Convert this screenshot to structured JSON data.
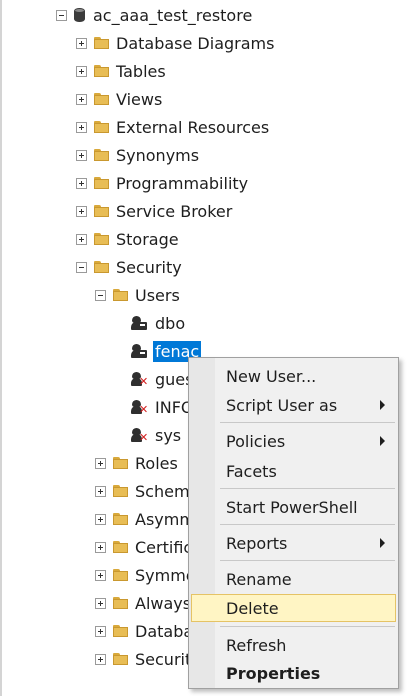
{
  "tree": {
    "database": "ac_aaa_test_restore",
    "folders": [
      "Database Diagrams",
      "Tables",
      "Views",
      "External Resources",
      "Synonyms",
      "Programmability",
      "Service Broker",
      "Storage",
      "Security"
    ],
    "security": {
      "users_folder": "Users",
      "users": [
        "dbo",
        "fenac",
        "guest",
        "INFORMATION_SCHEMA",
        "sys"
      ],
      "users_visible": [
        "dbo",
        "fenac",
        "gues",
        "INFO",
        "sys"
      ],
      "selected_user": "fenac",
      "folders": [
        "Roles",
        "Schemas",
        "Asymmetric Keys",
        "Certificates",
        "Symmetric Keys",
        "Always Encrypted Keys",
        "Database Audit Specifications",
        "Security Policies"
      ],
      "folders_visible": [
        "Roles",
        "Schema",
        "Asymm",
        "Certifica",
        "Symme",
        "Always",
        "Databa",
        "Security"
      ]
    }
  },
  "context_menu": {
    "new_user": "New User...",
    "script_user_as": "Script User as",
    "policies": "Policies",
    "facets": "Facets",
    "start_powershell": "Start PowerShell",
    "reports": "Reports",
    "rename": "Rename",
    "delete": "Delete",
    "refresh": "Refresh",
    "properties": "Properties",
    "highlighted": "Delete"
  },
  "colors": {
    "selection": "#0078d7",
    "menu_highlight": "#fff5c4",
    "folder": "#e8bd55"
  }
}
